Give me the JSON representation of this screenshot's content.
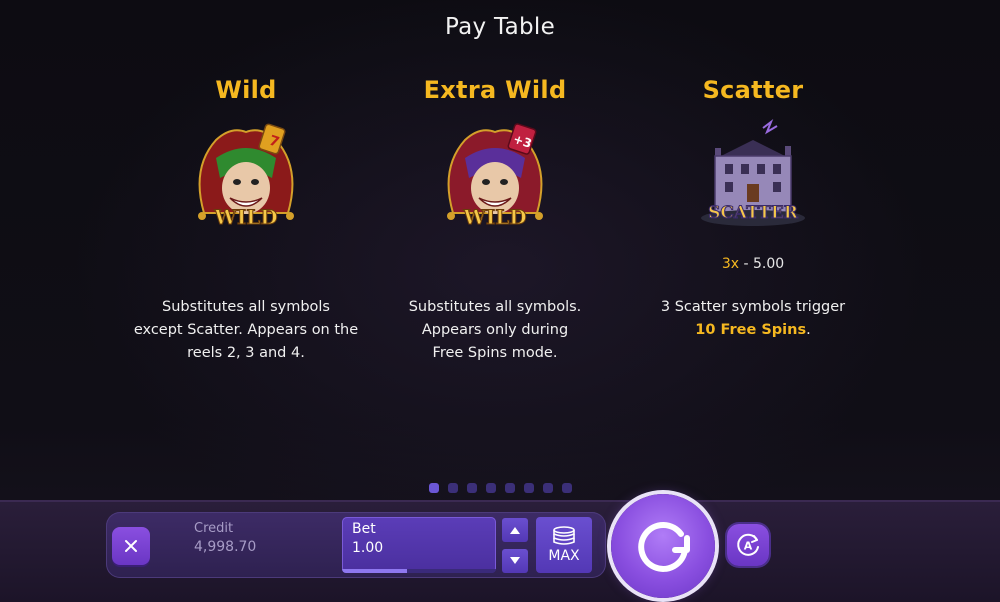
{
  "title": "Pay Table",
  "columns": [
    {
      "name": "Wild",
      "symbol_label": "WILD",
      "badge": "7",
      "payout_mult": "",
      "payout_value": "",
      "desc_lines": [
        "Substitutes all symbols",
        "except Scatter. Appears on the",
        "reels 2, 3 and 4."
      ]
    },
    {
      "name": "Extra Wild",
      "symbol_label": "WILD",
      "badge": "+3",
      "payout_mult": "",
      "payout_value": "",
      "desc_lines": [
        "Substitutes all symbols.",
        "Appears only during",
        "Free Spins mode."
      ]
    },
    {
      "name": "Scatter",
      "symbol_label": "SCATTER",
      "payout_mult": "3x",
      "payout_value": " - 5.00",
      "desc_line1": "3 Scatter symbols trigger",
      "desc_highlight": "10 Free Spins",
      "desc_end": "."
    }
  ],
  "pagination": {
    "count": 8,
    "active_index": 0
  },
  "controls": {
    "close_icon": "close-icon",
    "credit_label": "Credit",
    "credit_value": "4,998.70",
    "bet_label": "Bet",
    "bet_value": "1.00",
    "bet_level_fraction": 0.42,
    "max_label": "MAX",
    "spin_icon": "spin-arrow-icon",
    "auto_label": "A"
  },
  "colors": {
    "accent": "#f5b820",
    "primary": "#8a4fe0",
    "bar": "#2a1e3a"
  }
}
